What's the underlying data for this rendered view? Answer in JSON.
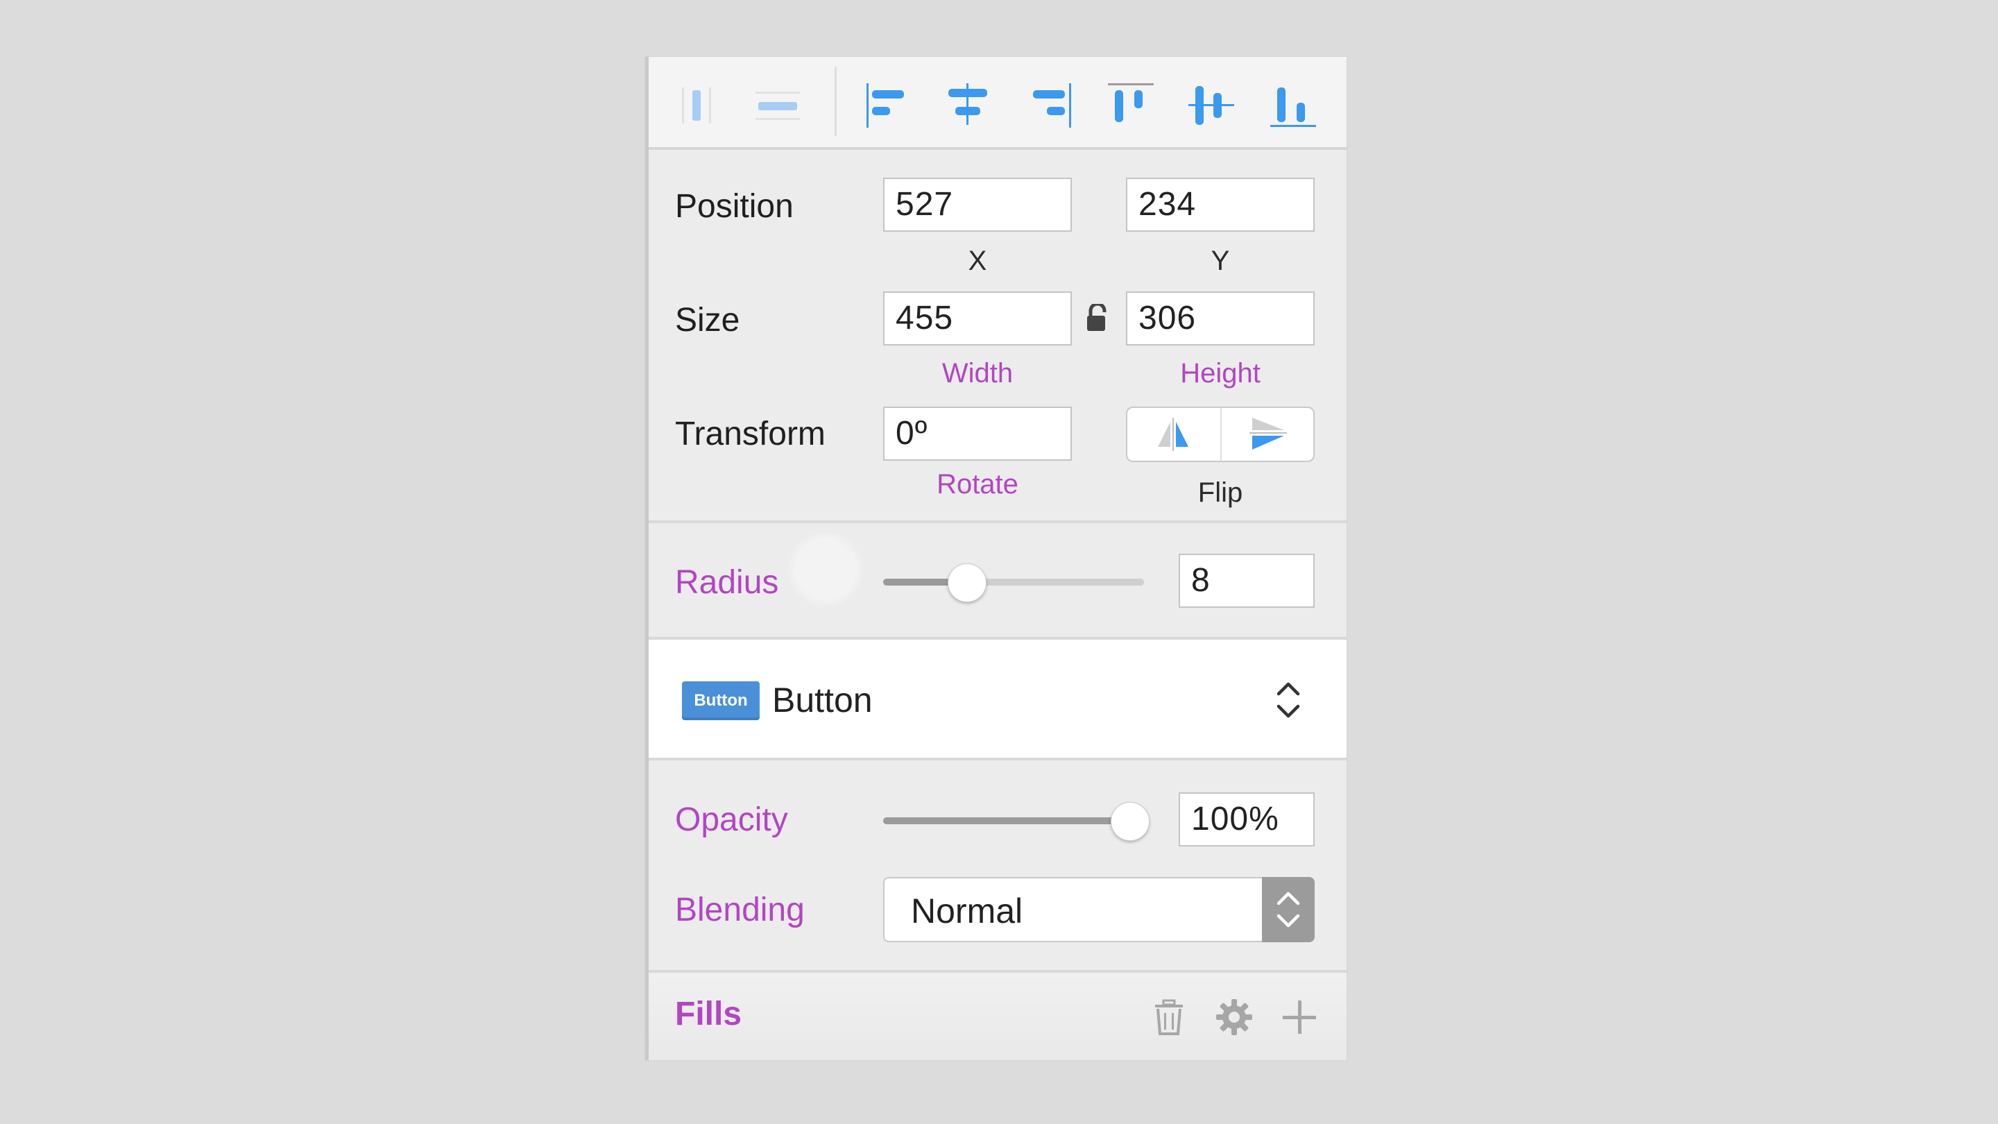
{
  "toolbar": {
    "icons": [
      "distribute-horizontal-icon",
      "distribute-vertical-icon",
      "align-left-icon",
      "align-center-horizontal-icon",
      "align-right-icon",
      "align-top-icon",
      "align-middle-vertical-icon",
      "align-bottom-icon"
    ]
  },
  "position": {
    "label": "Position",
    "x": "527",
    "x_label": "X",
    "y": "234",
    "y_label": "Y"
  },
  "size": {
    "label": "Size",
    "width": "455",
    "width_label": "Width",
    "height": "306",
    "height_label": "Height"
  },
  "transform": {
    "label": "Transform",
    "rotate": "0º",
    "rotate_label": "Rotate",
    "flip_label": "Flip"
  },
  "radius": {
    "label": "Radius",
    "value": "8",
    "slider_fraction": 0.32
  },
  "symbol": {
    "badge": "Button",
    "name": "Button"
  },
  "opacity": {
    "label": "Opacity",
    "value": "100%",
    "slider_fraction": 1.0
  },
  "blending": {
    "label": "Blending",
    "value": "Normal"
  },
  "fills": {
    "label": "Fills"
  },
  "colors": {
    "accent": "#b146c2",
    "icon_blue": "#3b99f0",
    "badge_blue": "#4a90d9"
  }
}
